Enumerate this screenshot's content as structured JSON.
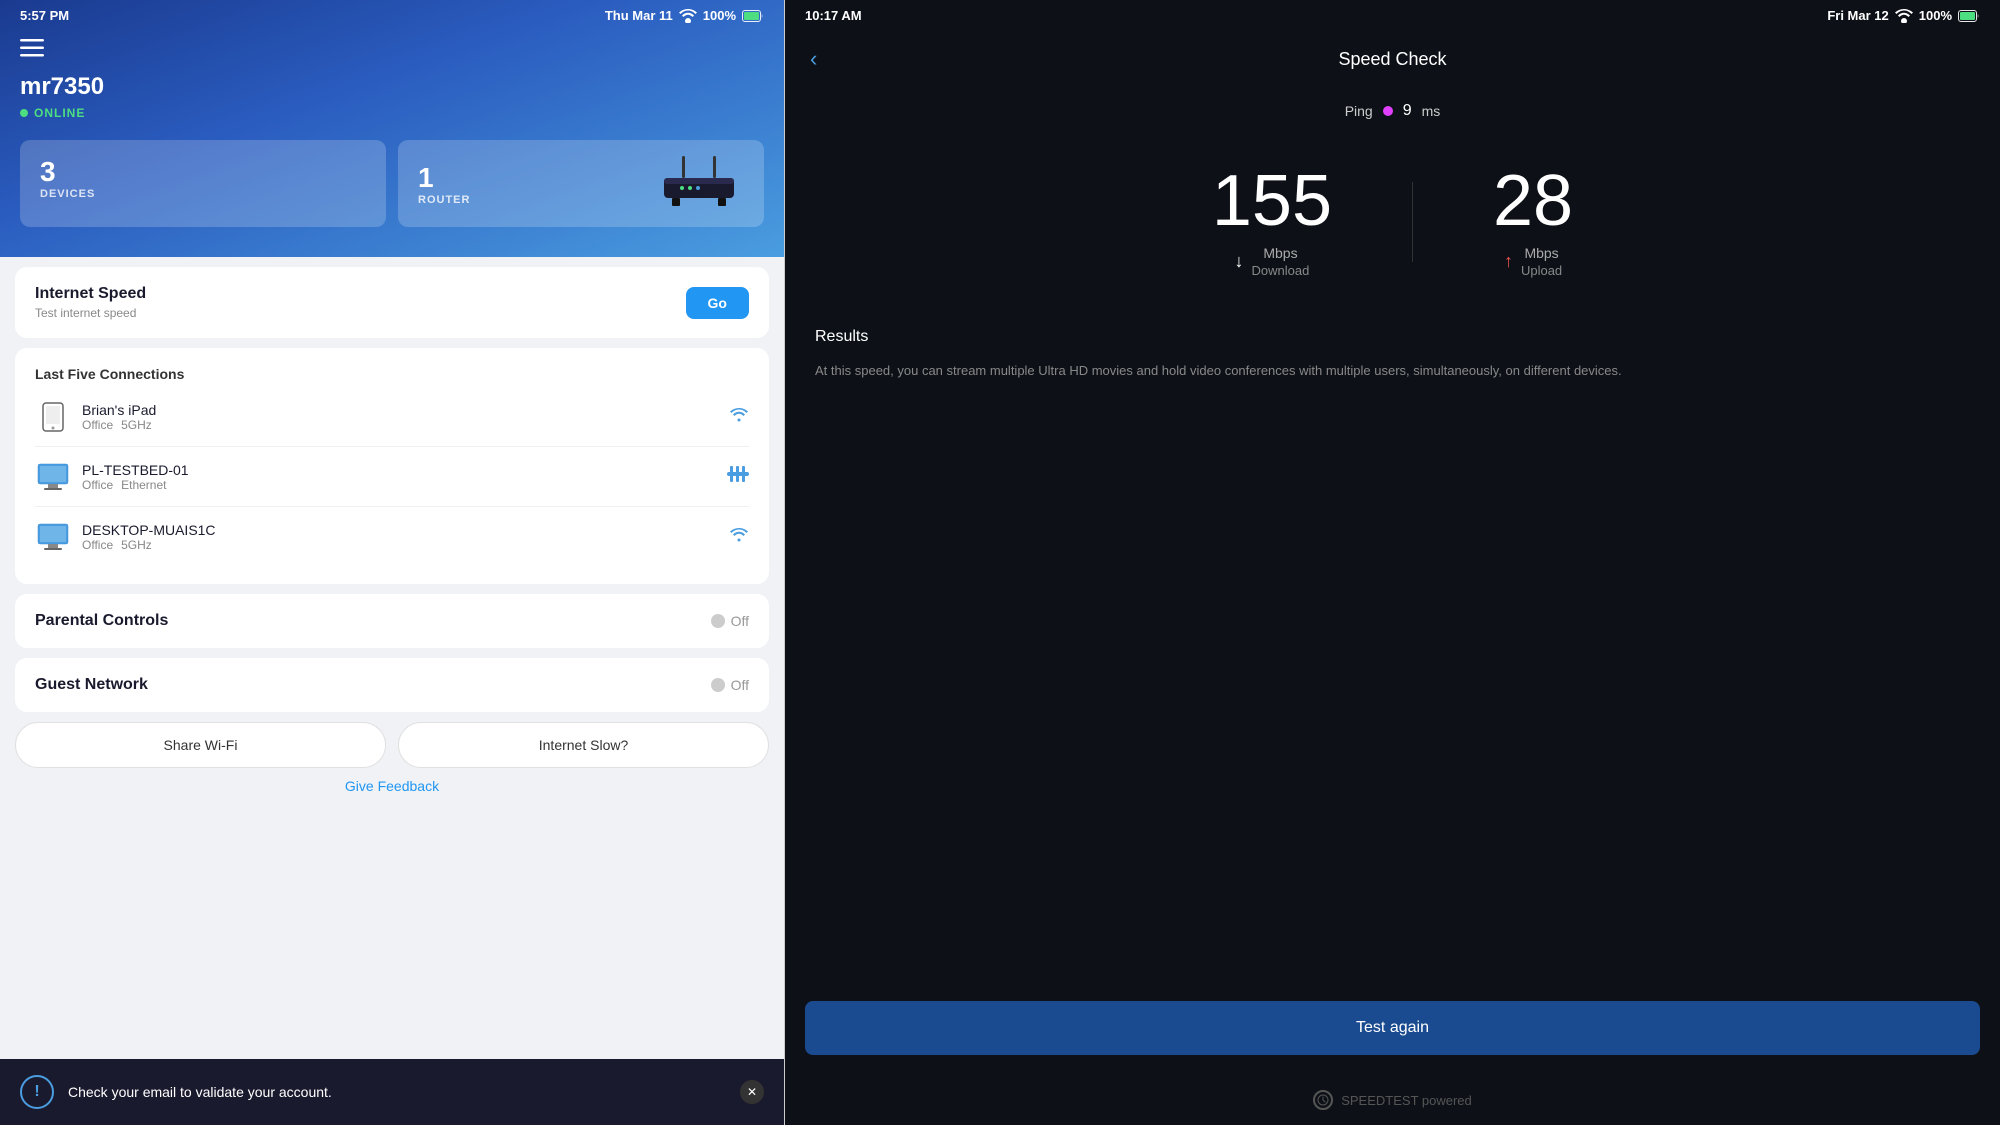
{
  "left": {
    "statusBar": {
      "time": "5:57 PM",
      "date": "Thu Mar 11",
      "battery": "100%"
    },
    "router": {
      "name": "mr7350",
      "status": "ONLINE"
    },
    "stats": {
      "devices": {
        "count": "3",
        "label": "DEVICES"
      },
      "router": {
        "count": "1",
        "label": "ROUTER"
      }
    },
    "internetSpeed": {
      "title": "Internet Speed",
      "subtitle": "Test internet speed",
      "goButton": "Go"
    },
    "lastConnections": {
      "title": "Last Five Connections",
      "devices": [
        {
          "name": "Brian's iPad",
          "location": "Office",
          "connection": "5GHz",
          "type": "phone"
        },
        {
          "name": "PL-TESTBED-01",
          "location": "Office",
          "connection": "Ethernet",
          "type": "desktop"
        },
        {
          "name": "DESKTOP-MUAIS1C",
          "location": "Office",
          "connection": "5GHz",
          "type": "desktop"
        }
      ]
    },
    "parentalControls": {
      "title": "Parental Controls",
      "status": "Off"
    },
    "guestNetwork": {
      "title": "Guest Network",
      "status": "Off"
    },
    "shareWifi": "Share Wi-Fi",
    "internetSlow": "Internet Slow?",
    "giveFeedback": "Give Feedback",
    "notification": {
      "text": "Check your email to validate your account."
    }
  },
  "right": {
    "statusBar": {
      "time": "10:17 AM",
      "date": "Fri Mar 12",
      "battery": "100%"
    },
    "title": "Speed Check",
    "ping": {
      "label": "Ping",
      "value": "9",
      "unit": "ms"
    },
    "download": {
      "value": "155",
      "unit": "Mbps",
      "type": "Download"
    },
    "upload": {
      "value": "28",
      "unit": "Mbps",
      "type": "Upload"
    },
    "results": {
      "label": "Results",
      "description": "At this speed, you can stream multiple Ultra HD movies and hold video conferences with multiple users, simultaneously, on different devices."
    },
    "testAgain": "Test again",
    "poweredBy": "SPEEDTEST powered"
  }
}
